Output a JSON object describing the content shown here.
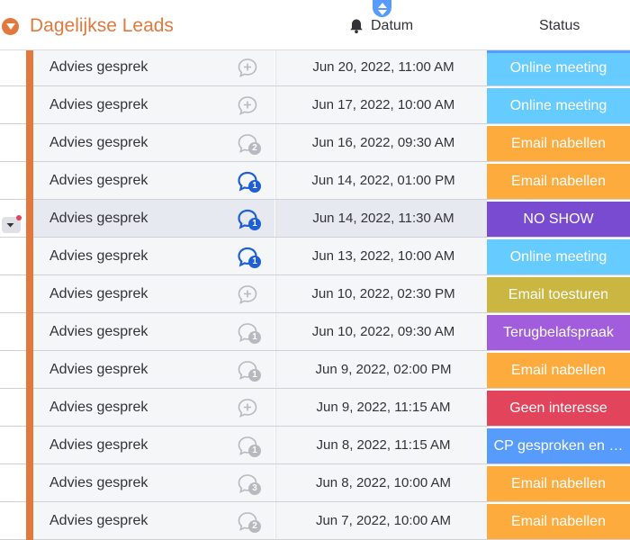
{
  "colors": {
    "group_accent": "#e2783d",
    "sort_badge": "#579bfc",
    "update_active": "#1f5fd6",
    "update_inactive": "#b8b9c0"
  },
  "header": {
    "group_title": "Dagelijkse Leads",
    "datum_label": "Datum",
    "status_label": "Status",
    "icons": [
      "chevron-down-icon",
      "bell-icon",
      "sort-icon"
    ]
  },
  "rows": [
    {
      "name": "Advies gesprek",
      "date": "Jun 20, 2022, 11:00 AM",
      "status": "Online meeting",
      "status_color": "#66ccff",
      "updates": "",
      "update_state": "empty"
    },
    {
      "name": "Advies gesprek",
      "date": "Jun 17, 2022, 10:00 AM",
      "status": "Online meeting",
      "status_color": "#66ccff",
      "updates": "",
      "update_state": "empty"
    },
    {
      "name": "Advies gesprek",
      "date": "Jun 16, 2022, 09:30 AM",
      "status": "Email nabellen",
      "status_color": "#fdab3d",
      "updates": "2",
      "update_state": "read"
    },
    {
      "name": "Advies gesprek",
      "date": "Jun 14, 2022, 01:00 PM",
      "status": "Email nabellen",
      "status_color": "#fdab3d",
      "updates": "1",
      "update_state": "unread"
    },
    {
      "name": "Advies gesprek",
      "date": "Jun 14, 2022, 11:30 AM",
      "status": "NO SHOW",
      "status_color": "#784bd1",
      "updates": "1",
      "update_state": "unread"
    },
    {
      "name": "Advies gesprek",
      "date": "Jun 13, 2022, 10:00 AM",
      "status": "Online meeting",
      "status_color": "#66ccff",
      "updates": "1",
      "update_state": "unread"
    },
    {
      "name": "Advies gesprek",
      "date": "Jun 10, 2022, 02:30 PM",
      "status": "Email toesturen",
      "status_color": "#cab641",
      "updates": "",
      "update_state": "empty"
    },
    {
      "name": "Advies gesprek",
      "date": "Jun 10, 2022, 09:30 AM",
      "status": "Terugbelafspraak",
      "status_color": "#a25ddc",
      "updates": "1",
      "update_state": "read"
    },
    {
      "name": "Advies gesprek",
      "date": "Jun 9, 2022, 02:00 PM",
      "status": "Email nabellen",
      "status_color": "#fdab3d",
      "updates": "1",
      "update_state": "read"
    },
    {
      "name": "Advies gesprek",
      "date": "Jun 9, 2022, 11:15 AM",
      "status": "Geen interesse",
      "status_color": "#e2445c",
      "updates": "",
      "update_state": "empty"
    },
    {
      "name": "Advies gesprek",
      "date": "Jun 8, 2022, 11:15 AM",
      "status": "CP gesproken en …",
      "status_color": "#579bfc",
      "updates": "1",
      "update_state": "read"
    },
    {
      "name": "Advies gesprek",
      "date": "Jun 8, 2022, 10:00 AM",
      "status": "Email nabellen",
      "status_color": "#fdab3d",
      "updates": "3",
      "update_state": "read"
    },
    {
      "name": "Advies gesprek",
      "date": "Jun 7, 2022, 10:00 AM",
      "status": "Email nabellen",
      "status_color": "#fdab3d",
      "updates": "2",
      "update_state": "read"
    }
  ]
}
